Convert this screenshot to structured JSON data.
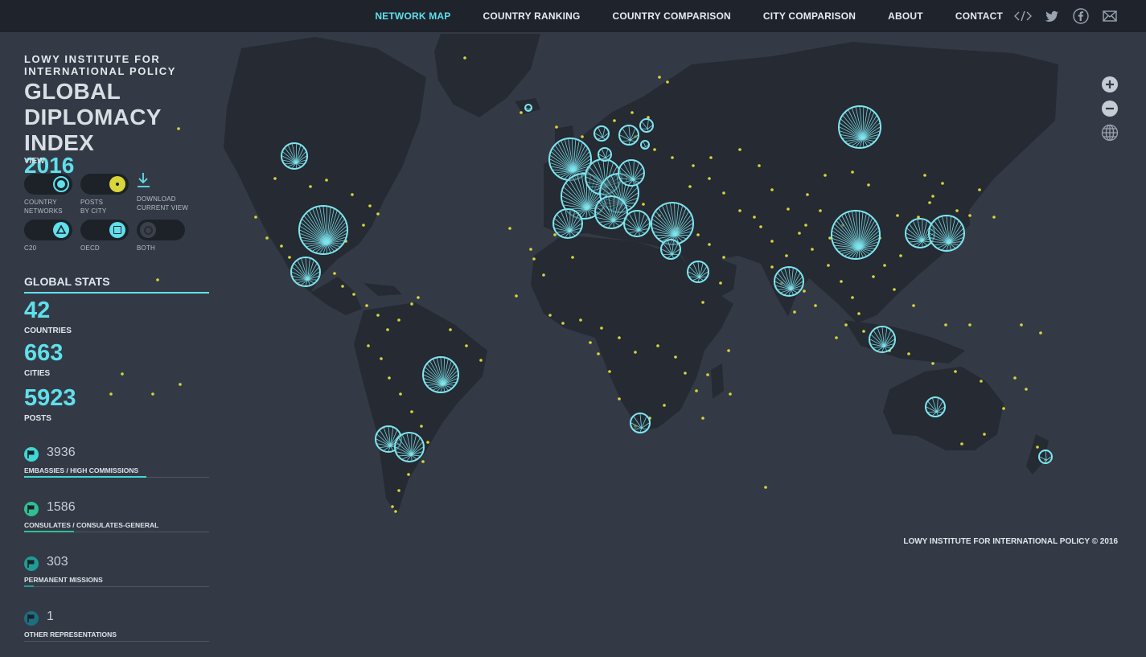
{
  "nav": {
    "items": [
      "NETWORK MAP",
      "COUNTRY RANKING",
      "COUNTRY COMPARISON",
      "CITY COMPARISON",
      "ABOUT",
      "CONTACT"
    ],
    "active": 0
  },
  "social_icons": [
    "embed-icon",
    "twitter-icon",
    "facebook-icon",
    "email-icon"
  ],
  "header": {
    "org": "LOWY INSTITUTE FOR INTERNATIONAL POLICY",
    "title": "GLOBAL DIPLOMACY INDEX",
    "year": "2016"
  },
  "view": {
    "label": "VIEW",
    "toggles": [
      {
        "line1": "COUNTRY",
        "line2": "NETWORKS",
        "icon": "circle",
        "color": "#5fe0ec",
        "on": true
      },
      {
        "line1": "POSTS",
        "line2": "BY CITY",
        "icon": "dot",
        "color": "#d9d63a",
        "on": true
      },
      {
        "line1": "C20",
        "line2": "",
        "icon": "triangle",
        "color": "#5fe0ec",
        "on": true
      },
      {
        "line1": "OECD",
        "line2": "",
        "icon": "square",
        "color": "#5fe0ec",
        "on": true
      },
      {
        "line1": "BOTH",
        "line2": "",
        "icon": "ring",
        "color": "#4a505a",
        "on": false
      }
    ],
    "download": {
      "line1": "DOWNLOAD",
      "line2": "CURRENT VIEW"
    }
  },
  "global_stats": {
    "title": "GLOBAL STATS",
    "countries": {
      "value": "42",
      "label": "COUNTRIES"
    },
    "cities": {
      "value": "663",
      "label": "CITIES"
    },
    "posts": {
      "value": "5923",
      "label": "POSTS"
    }
  },
  "post_types": [
    {
      "value": "3936",
      "label": "EMBASSIES / HIGH COMMISSIONS",
      "color": "#3fd8d6",
      "share": 0.66
    },
    {
      "value": "1586",
      "label": "CONSULATES / CONSULATES-GENERAL",
      "color": "#2fbf93",
      "share": 0.27
    },
    {
      "value": "303",
      "label": "PERMANENT MISSIONS",
      "color": "#1f9c97",
      "share": 0.05
    },
    {
      "value": "1",
      "label": "OTHER REPRESENTATIONS",
      "color": "#1d6f80",
      "share": 0.0
    }
  ],
  "map": {
    "background_color": "#343a45",
    "land_color": "#252a33",
    "network_color": "#7ee6ef",
    "post_color": "#d9d63a",
    "zoom_controls": [
      "zoom-in-icon",
      "zoom-out-icon",
      "globe-icon"
    ],
    "copyright": "LOWY INSTITUTE FOR INTERNATIONAL POLICY © 2016"
  }
}
